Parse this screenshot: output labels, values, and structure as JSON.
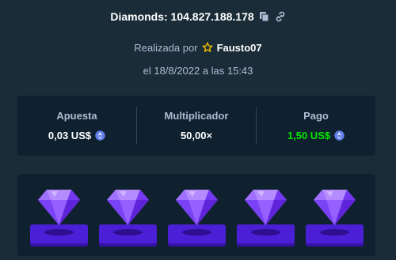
{
  "header": {
    "title": "Diamonds: 104.827.188.178",
    "copy_icon": "copy-icon",
    "link_icon": "link-icon"
  },
  "meta": {
    "made_by_label": "Realizada por",
    "user_icon": "star-icon",
    "username": "Fausto07",
    "date_text": "el 18/8/2022 a las 15:43"
  },
  "stats": {
    "bet": {
      "label": "Apuesta",
      "value": "0,03 US$",
      "icon": "coin-icon"
    },
    "multiplier": {
      "label": "Multiplicador",
      "value": "50,00×"
    },
    "payout": {
      "label": "Pago",
      "value": "1,50 US$",
      "icon": "coin-icon",
      "color": "#00e701"
    }
  },
  "gems": [
    {
      "type": "purple-diamond"
    },
    {
      "type": "purple-diamond"
    },
    {
      "type": "purple-diamond"
    },
    {
      "type": "purple-diamond"
    },
    {
      "type": "purple-diamond"
    }
  ],
  "colors": {
    "background": "#1a2c38",
    "panel": "#0f212e",
    "muted_text": "#b1bad3",
    "success": "#00e701",
    "gem_purple": "#8a52ff",
    "tile_purple": "#4b1fd6"
  }
}
